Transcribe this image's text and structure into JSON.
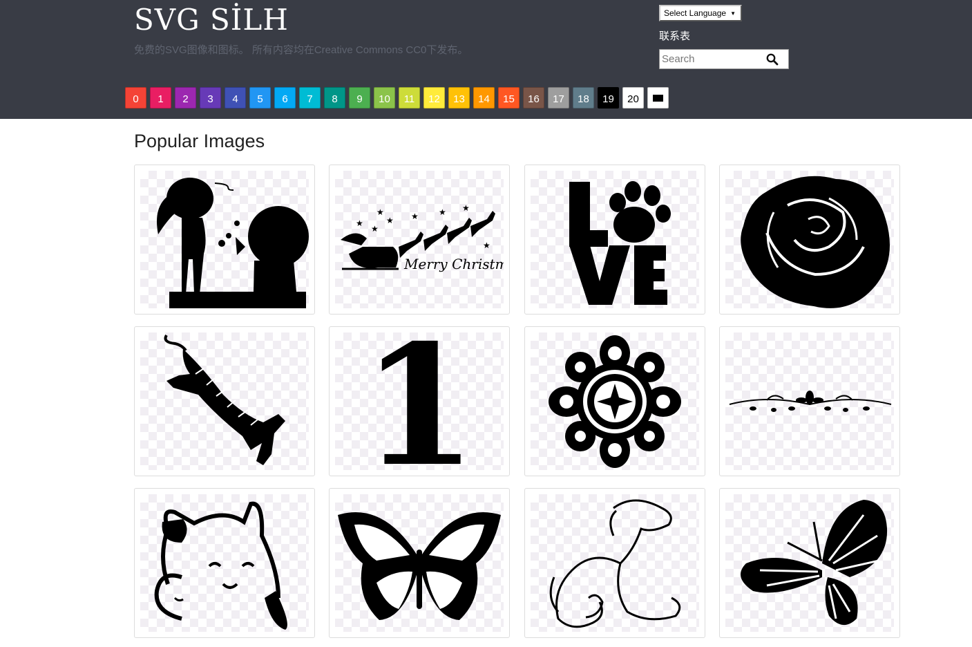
{
  "site": {
    "logo": "SVG SİLH",
    "tagline": "免费的SVG图像和图标。 所有内容均在Creative Commons CC0下发布。"
  },
  "language_select": {
    "label": "Select Language"
  },
  "contact_link": "联系表",
  "search": {
    "placeholder": "Search",
    "icon": "search-icon"
  },
  "swatches": [
    {
      "label": "0",
      "color": "#f44336",
      "text": "#ffffff"
    },
    {
      "label": "1",
      "color": "#e91e63",
      "text": "#ffffff"
    },
    {
      "label": "2",
      "color": "#9c27b0",
      "text": "#ffffff"
    },
    {
      "label": "3",
      "color": "#673ab7",
      "text": "#ffffff"
    },
    {
      "label": "4",
      "color": "#3f51b5",
      "text": "#ffffff"
    },
    {
      "label": "5",
      "color": "#2196f3",
      "text": "#ffffff"
    },
    {
      "label": "6",
      "color": "#03a9f4",
      "text": "#ffffff"
    },
    {
      "label": "7",
      "color": "#00bcd4",
      "text": "#ffffff"
    },
    {
      "label": "8",
      "color": "#009688",
      "text": "#ffffff"
    },
    {
      "label": "9",
      "color": "#4caf50",
      "text": "#ffffff"
    },
    {
      "label": "10",
      "color": "#8bc34a",
      "text": "#ffffff"
    },
    {
      "label": "11",
      "color": "#cddc39",
      "text": "#ffffff"
    },
    {
      "label": "12",
      "color": "#ffeb3b",
      "text": "#ffffff"
    },
    {
      "label": "13",
      "color": "#ffc107",
      "text": "#ffffff"
    },
    {
      "label": "14",
      "color": "#ff9800",
      "text": "#ffffff"
    },
    {
      "label": "15",
      "color": "#ff5722",
      "text": "#ffffff"
    },
    {
      "label": "16",
      "color": "#795548",
      "text": "#ffffff"
    },
    {
      "label": "17",
      "color": "#9e9e9e",
      "text": "#ffffff"
    },
    {
      "label": "18",
      "color": "#607d8b",
      "text": "#ffffff"
    },
    {
      "label": "19",
      "color": "#000000",
      "text": "#ffffff"
    },
    {
      "label": "20",
      "color": "#ffffff",
      "text": "#000000"
    },
    {
      "label": "",
      "color": "#ffffff",
      "text": "#000000",
      "icon": "black-rectangle-icon"
    }
  ],
  "section_title": "Popular Images",
  "images": [
    {
      "name": "couple-silhouette"
    },
    {
      "name": "santa-sleigh-merry-christmas",
      "caption": "Merry Christmas"
    },
    {
      "name": "love-paw-print",
      "caption": "LOVE"
    },
    {
      "name": "rose-flower"
    },
    {
      "name": "leaping-tiger"
    },
    {
      "name": "number-one",
      "caption": "1"
    },
    {
      "name": "mandala-flower"
    },
    {
      "name": "floral-divider"
    },
    {
      "name": "lucky-cat"
    },
    {
      "name": "monarch-butterfly"
    },
    {
      "name": "dog-cat-line-art"
    },
    {
      "name": "butterfly-silhouette"
    }
  ]
}
